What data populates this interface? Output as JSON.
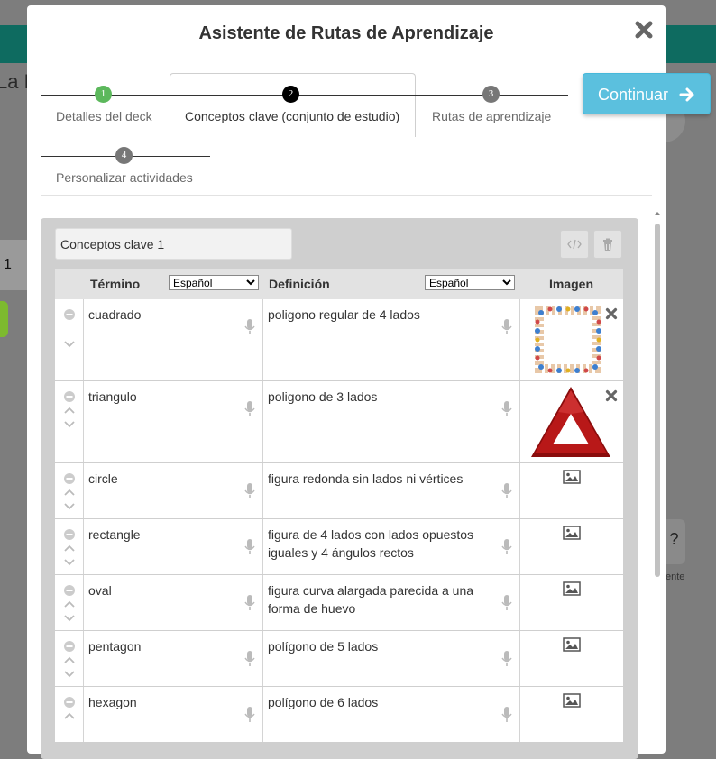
{
  "background": {
    "partial_title": "La E",
    "side_value": "1",
    "help_label": "ente"
  },
  "modal": {
    "title": "Asistente de Rutas de Aprendizaje",
    "continue_label": "Continuar",
    "steps": [
      {
        "number": "1",
        "label": "Detalles del deck",
        "color": "#5cb85c"
      },
      {
        "number": "2",
        "label": "Conceptos clave (conjunto de estudio)",
        "color": "#000000",
        "active": true
      },
      {
        "number": "3",
        "label": "Rutas de aprendizaje",
        "color": "#777777"
      },
      {
        "number": "4",
        "label": "Personalizar actividades",
        "color": "#777777"
      }
    ]
  },
  "study_set": {
    "name": "Conceptos clave 1",
    "columns": {
      "term": "Término",
      "term_language": "Español",
      "definition": "Definición",
      "definition_language": "Español",
      "image": "Imagen"
    },
    "rows": [
      {
        "term": "cuadrado",
        "definition": "poligono regular de 4 lados",
        "image": "kids-square-frame"
      },
      {
        "term": "triangulo",
        "definition": "poligono de 3 lados",
        "image": "red-warning-triangle"
      },
      {
        "term": "circle",
        "definition": "figura redonda sin lados ni vértices",
        "image": ""
      },
      {
        "term": "rectangle",
        "definition": "figura de 4 lados con lados opuestos iguales y 4 ángulos rectos",
        "image": ""
      },
      {
        "term": "oval",
        "definition": "figura curva alargada parecida a una forma de huevo",
        "image": ""
      },
      {
        "term": "pentagon",
        "definition": "polígono de 5 lados",
        "image": ""
      },
      {
        "term": "hexagon",
        "definition": "polígono de 6 lados",
        "image": ""
      }
    ]
  },
  "colors": {
    "accent": "#5bc0de",
    "header_bar": "#0e6b60",
    "step_done": "#5cb85c"
  }
}
